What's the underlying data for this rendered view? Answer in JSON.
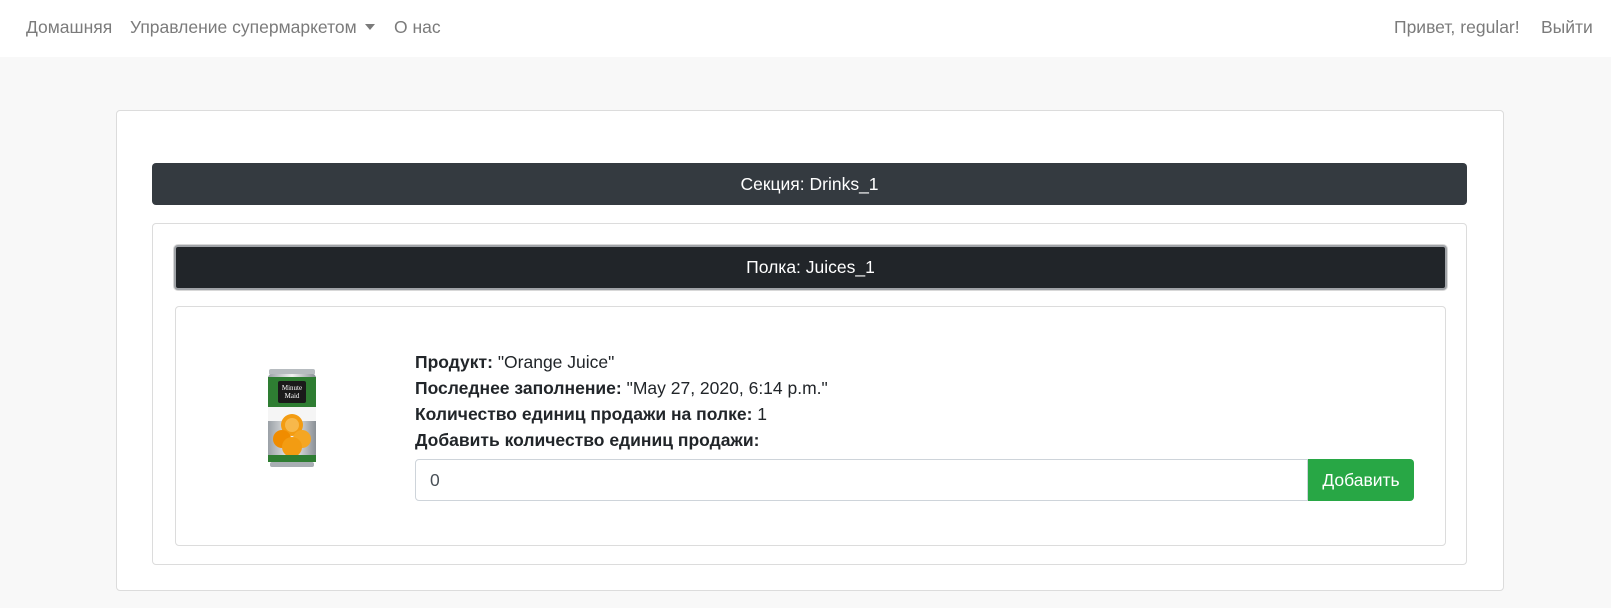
{
  "navbar": {
    "home": "Домашняя",
    "manage": "Управление супермаркетом",
    "about": "О нас",
    "greeting": "Привет,",
    "username": "regular!",
    "logout": "Выйти"
  },
  "section": {
    "title": "Секция: Drinks_1"
  },
  "shelf": {
    "title": "Полка: Juices_1"
  },
  "product": {
    "image_icon": "orange-juice-can",
    "image_brand": "Minute Maid",
    "name_label": "Продукт:",
    "name_value": "\"Orange Juice\"",
    "refill_label": "Последнее заполнение:",
    "refill_value": "\"May 27, 2020, 6:14 p.m.\"",
    "count_label": "Количество единиц продажи на полке:",
    "count_value": "1",
    "add_label": "Добавить количество единиц продажи:",
    "quantity_value": "0",
    "add_button": "Добавить"
  },
  "colors": {
    "section_header": "#343a40",
    "shelf_header": "#212529",
    "add_button": "#28a745"
  }
}
